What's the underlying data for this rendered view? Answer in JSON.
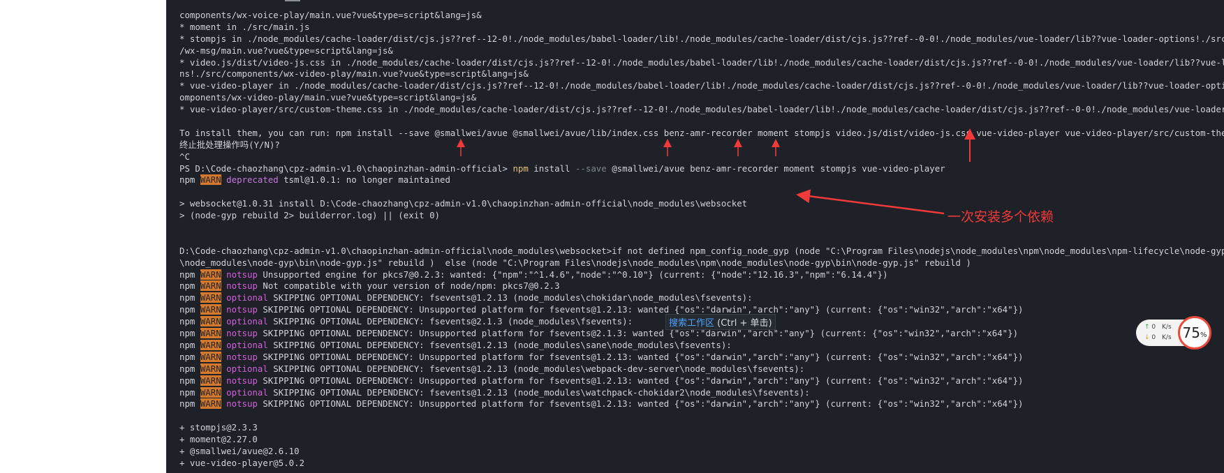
{
  "colors": {
    "terminal_bg": "#1e2127",
    "text": "#d0d4da",
    "warn_bg": "#d47a2a",
    "deprecated": "#c678dd",
    "notsup_optional": "#d55fde",
    "annotation_red": "#f03a3a",
    "tooltip_link": "#4da3ff"
  },
  "terminal": {
    "lines": [
      [
        {
          "t": "components/wx-voice-play/main.vue?vue&type=script&lang=js&"
        }
      ],
      [
        {
          "t": "* moment in ./src/main.js"
        }
      ],
      [
        {
          "t": "* stompjs in ./node_modules/cache-loader/dist/cjs.js??ref--12-0!./node_modules/babel-loader/lib!./node_modules/cache-loader/dist/cjs.js??ref--0-0!./node_modules/vue-loader/lib??vue-loader-options!./src/components"
        }
      ],
      [
        {
          "t": "/wx-msg/main.vue?vue&type=script&lang=js&"
        }
      ],
      [
        {
          "t": "* video.js/dist/video-js.css in ./node_modules/cache-loader/dist/cjs.js??ref--12-0!./node_modules/babel-loader/lib!./node_modules/cache-loader/dist/cjs.js??ref--0-0!./node_modules/vue-loader/lib??vue-loader-optio"
        }
      ],
      [
        {
          "t": "ns!./src/components/wx-video-play/main.vue?vue&type=script&lang=js&"
        }
      ],
      [
        {
          "t": "* vue-video-player in ./node_modules/cache-loader/dist/cjs.js??ref--12-0!./node_modules/babel-loader/lib!./node_modules/cache-loader/dist/cjs.js??ref--0-0!./node_modules/vue-loader/lib??vue-loader-options!./src/c"
        }
      ],
      [
        {
          "t": "omponents/wx-video-play/main.vue?vue&type=script&lang=js&"
        }
      ],
      [
        {
          "t": "* vue-video-player/src/custom-theme.css in ./node_modules/cache-loader/dist/cjs.js??ref--12-0!./node_modules/babel-loader/lib!./node_modules/cache-loader/dist/cjs.js??ref--0-0!./node_modules/vue-loader/lib??vue-l"
        }
      ],
      [
        {
          "t": ""
        }
      ],
      [
        {
          "t": "To install them, you can run: npm install --save @smallwei/avue @smallwei/avue/lib/index.css benz-amr-recorder moment stompjs video.js/dist/video-js.css vue-video-player vue-video-player/src/custom-theme.css"
        }
      ],
      [
        {
          "t": "终止批处理操作吗(Y/N)?"
        }
      ],
      [
        {
          "t": "^C"
        }
      ],
      [
        {
          "t": "PS D:\\Code-chaozhang\\cpz-admin-v1.0\\chaopinzhan-admin-official> "
        },
        {
          "t": "npm",
          "c": "c-cmd"
        },
        {
          "t": " install "
        },
        {
          "t": "--save",
          "c": "c-dim"
        },
        {
          "t": " @smallwei/avue benz-amr-recorder moment stompjs vue-video-player"
        }
      ],
      [
        {
          "t": "npm "
        },
        {
          "t": "WARN",
          "c": "c-warn"
        },
        {
          "t": " "
        },
        {
          "t": "deprecated",
          "c": "c-dep"
        },
        {
          "t": " tsml@1.0.1: no longer maintained"
        }
      ],
      [
        {
          "t": ""
        }
      ],
      [
        {
          "t": "> websocket@1.0.31 install D:\\Code-chaozhang\\cpz-admin-v1.0\\chaopinzhan-admin-official\\node_modules\\websocket"
        }
      ],
      [
        {
          "t": "> (node-gyp rebuild 2> builderror.log) || (exit 0)"
        }
      ],
      [
        {
          "t": ""
        }
      ],
      [
        {
          "t": ""
        }
      ],
      [
        {
          "t": "D:\\Code-chaozhang\\cpz-admin-v1.0\\chaopinzhan-admin-official\\node_modules\\websocket>if not defined npm_config_node_gyp (node \"C:\\Program Files\\nodejs\\node_modules\\npm\\node_modules\\npm-lifecycle\\node-gyp-bin\\\\..\\.."
        }
      ],
      [
        {
          "t": "\\node_modules\\node-gyp\\bin\\node-gyp.js\" rebuild )  else (node \"C:\\Program Files\\nodejs\\node_modules\\npm\\node_modules\\node-gyp\\bin\\node-gyp.js\" rebuild )"
        }
      ],
      [
        {
          "t": "npm "
        },
        {
          "t": "WARN",
          "c": "c-warn"
        },
        {
          "t": " "
        },
        {
          "t": "notsup",
          "c": "c-pink"
        },
        {
          "t": " Unsupported engine for pkcs7@0.2.3: wanted: {\"npm\":\"^1.4.6\",\"node\":\"^0.10\"} (current: {\"node\":\"12.16.3\",\"npm\":\"6.14.4\"})"
        }
      ],
      [
        {
          "t": "npm "
        },
        {
          "t": "WARN",
          "c": "c-warn"
        },
        {
          "t": " "
        },
        {
          "t": "notsup",
          "c": "c-pink"
        },
        {
          "t": " Not compatible with your version of node/npm: pkcs7@0.2.3"
        }
      ],
      [
        {
          "t": "npm "
        },
        {
          "t": "WARN",
          "c": "c-warn"
        },
        {
          "t": " "
        },
        {
          "t": "optional",
          "c": "c-pink"
        },
        {
          "t": " SKIPPING OPTIONAL DEPENDENCY: fsevents@1.2.13 (node_modules\\chokidar\\node_modules\\fsevents):"
        }
      ],
      [
        {
          "t": "npm "
        },
        {
          "t": "WARN",
          "c": "c-warn"
        },
        {
          "t": " "
        },
        {
          "t": "notsup",
          "c": "c-pink"
        },
        {
          "t": " SKIPPING OPTIONAL DEPENDENCY: Unsupported platform for fsevents@1.2.13: wanted {\"os\":\"darwin\",\"arch\":\"any\"} (current: {\"os\":\"win32\",\"arch\":\"x64\"})"
        }
      ],
      [
        {
          "t": "npm "
        },
        {
          "t": "WARN",
          "c": "c-warn"
        },
        {
          "t": " "
        },
        {
          "t": "optional",
          "c": "c-pink"
        },
        {
          "t": " SKIPPING OPTIONAL DEPENDENCY: fsevents@2.1.3 (node_modules\\fsevents):"
        }
      ],
      [
        {
          "t": "npm "
        },
        {
          "t": "WARN",
          "c": "c-warn"
        },
        {
          "t": " "
        },
        {
          "t": "notsup",
          "c": "c-pink"
        },
        {
          "t": " SKIPPING OPTIONAL DEPENDENCY: Unsupported platform for fsevents@2.1.3: wanted {\"os\":\"darwin\",\"arch\":\"any\"} (current: {\"os\":\"win32\",\"arch\":\"x64\"})"
        }
      ],
      [
        {
          "t": "npm "
        },
        {
          "t": "WARN",
          "c": "c-warn"
        },
        {
          "t": " "
        },
        {
          "t": "optional",
          "c": "c-pink"
        },
        {
          "t": " SKIPPING OPTIONAL DEPENDENCY: fsevents@1.2.13 (node_modules\\sane\\node_modules\\fsevents):"
        }
      ],
      [
        {
          "t": "npm "
        },
        {
          "t": "WARN",
          "c": "c-warn"
        },
        {
          "t": " "
        },
        {
          "t": "notsup",
          "c": "c-pink"
        },
        {
          "t": " SKIPPING OPTIONAL DEPENDENCY: Unsupported platform for fsevents@1.2.13: wanted {\"os\":\"darwin\",\"arch\":\"any\"} (current: {\"os\":\"win32\",\"arch\":\"x64\"})"
        }
      ],
      [
        {
          "t": "npm "
        },
        {
          "t": "WARN",
          "c": "c-warn"
        },
        {
          "t": " "
        },
        {
          "t": "optional",
          "c": "c-pink"
        },
        {
          "t": " SKIPPING OPTIONAL DEPENDENCY: fsevents@1.2.13 (node_modules\\webpack-dev-server\\node_modules\\fsevents):"
        }
      ],
      [
        {
          "t": "npm "
        },
        {
          "t": "WARN",
          "c": "c-warn"
        },
        {
          "t": " "
        },
        {
          "t": "notsup",
          "c": "c-pink"
        },
        {
          "t": " SKIPPING OPTIONAL DEPENDENCY: Unsupported platform for fsevents@1.2.13: wanted {\"os\":\"darwin\",\"arch\":\"any\"} (current: {\"os\":\"win32\",\"arch\":\"x64\"})"
        }
      ],
      [
        {
          "t": "npm "
        },
        {
          "t": "WARN",
          "c": "c-warn"
        },
        {
          "t": " "
        },
        {
          "t": "optional",
          "c": "c-pink"
        },
        {
          "t": " SKIPPING OPTIONAL DEPENDENCY: fsevents@1.2.13 (node_modules\\watchpack-chokidar2\\node_modules\\fsevents):"
        }
      ],
      [
        {
          "t": "npm "
        },
        {
          "t": "WARN",
          "c": "c-warn"
        },
        {
          "t": " "
        },
        {
          "t": "notsup",
          "c": "c-pink"
        },
        {
          "t": " SKIPPING OPTIONAL DEPENDENCY: Unsupported platform for fsevents@1.2.13: wanted {\"os\":\"darwin\",\"arch\":\"any\"} (current: {\"os\":\"win32\",\"arch\":\"x64\"})"
        }
      ],
      [
        {
          "t": ""
        }
      ],
      [
        {
          "t": "+ stompjs@2.3.3"
        }
      ],
      [
        {
          "t": "+ moment@2.27.0"
        }
      ],
      [
        {
          "t": "+ @smallwei/avue@2.6.10"
        }
      ],
      [
        {
          "t": "+ vue-video-player@5.0.2"
        }
      ]
    ]
  },
  "annotation": {
    "text": "一次安装多个依赖"
  },
  "tooltip": {
    "link": "搜索工作区",
    "hint": " (Ctrl + 单击)"
  },
  "speed_widget": {
    "up_icon": "up-arrow-icon",
    "up_value": "0",
    "up_unit": "K/s",
    "down_icon": "down-arrow-icon",
    "down_value": "0",
    "down_unit": "K/s",
    "cpu_value": "75",
    "cpu_unit": "%"
  }
}
